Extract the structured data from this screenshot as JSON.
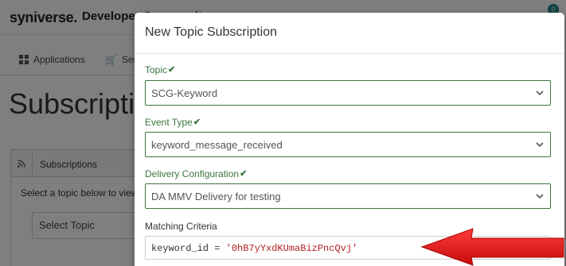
{
  "background": {
    "logo": "syniverse",
    "logo_dot": ".",
    "portal_title": "Developer Community",
    "notification_count": "0",
    "nav": {
      "applications": "Applications",
      "services": "Services"
    },
    "page_heading": "Subscriptions",
    "panel": {
      "title": "Subscriptions",
      "hint": "Select a topic below to view",
      "select_placeholder": "Select Topic"
    }
  },
  "modal": {
    "title": "New Topic Subscription",
    "topic": {
      "label": "Topic",
      "value": "SCG-Keyword"
    },
    "event_type": {
      "label": "Event Type",
      "value": "keyword_message_received"
    },
    "delivery": {
      "label": "Delivery Configuration",
      "value": "DA MMV Delivery for testing"
    },
    "criteria": {
      "label": "Matching Criteria",
      "code_key": "keyword_id = ",
      "code_value": "'0hB7yYxdKUmaBizPncQvj'"
    }
  },
  "colors": {
    "valid_green": "#3c763d",
    "annotation_arrow": "#e01a1a",
    "overlay": "rgba(0,0,0,0.5)"
  }
}
